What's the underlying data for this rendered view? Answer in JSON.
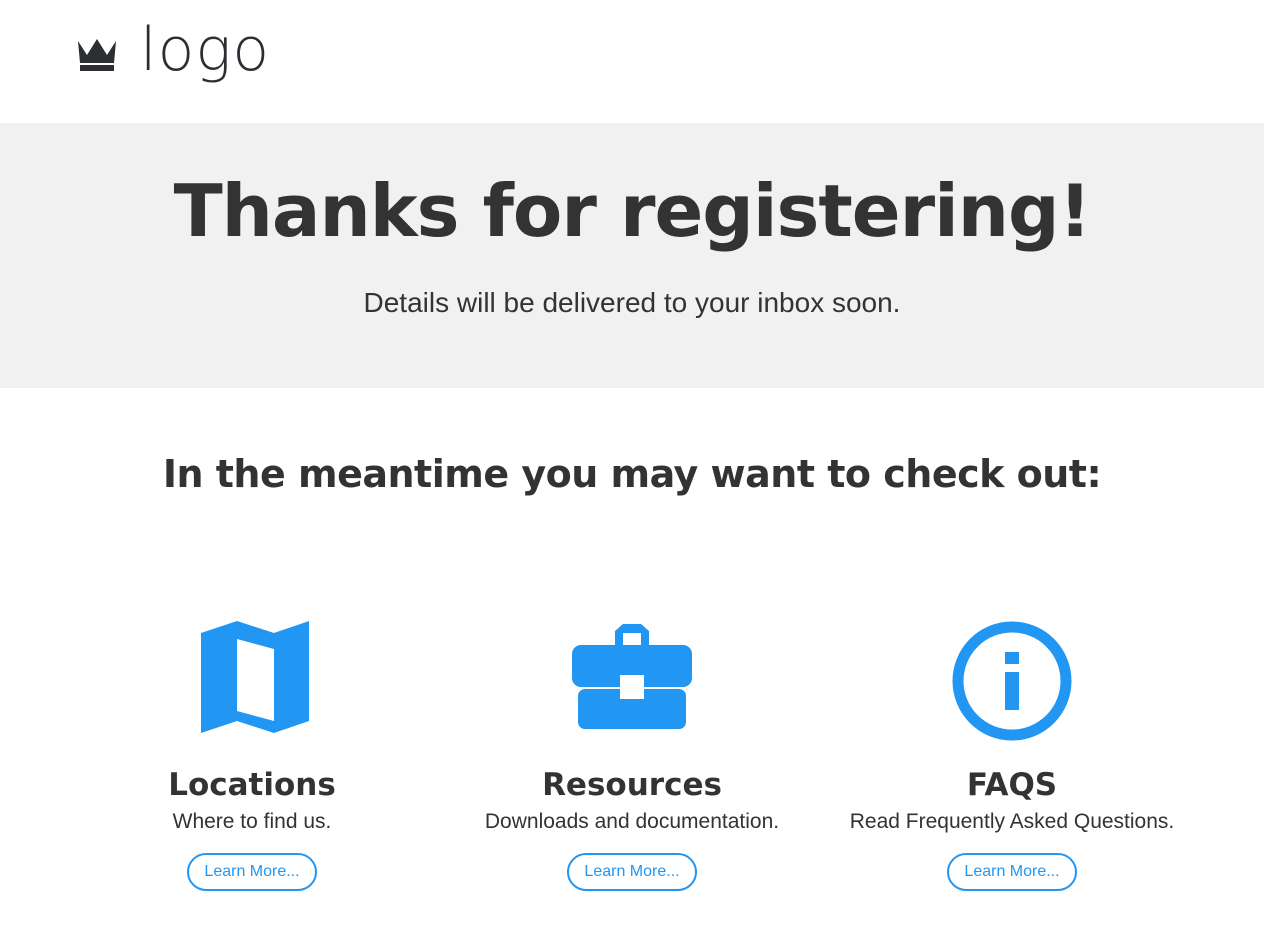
{
  "header": {
    "logo_text": "logo",
    "logo_icon": "crown-icon"
  },
  "hero": {
    "title": "Thanks for registering!",
    "subtitle": "Details will be delivered to your inbox soon."
  },
  "section": {
    "heading": "In the meantime you may want to check out:"
  },
  "cards": [
    {
      "icon": "map-icon",
      "title": "Locations",
      "description": "Where to find us.",
      "button_label": "Learn More..."
    },
    {
      "icon": "briefcase-icon",
      "title": "Resources",
      "description": "Downloads and documentation.",
      "button_label": "Learn More..."
    },
    {
      "icon": "info-circle-icon",
      "title": "FAQS",
      "description": "Read Frequently Asked Questions.",
      "button_label": "Learn More..."
    }
  ],
  "colors": {
    "accent": "#2196f3",
    "text": "#333333",
    "hero_background": "#f1f1f1"
  }
}
